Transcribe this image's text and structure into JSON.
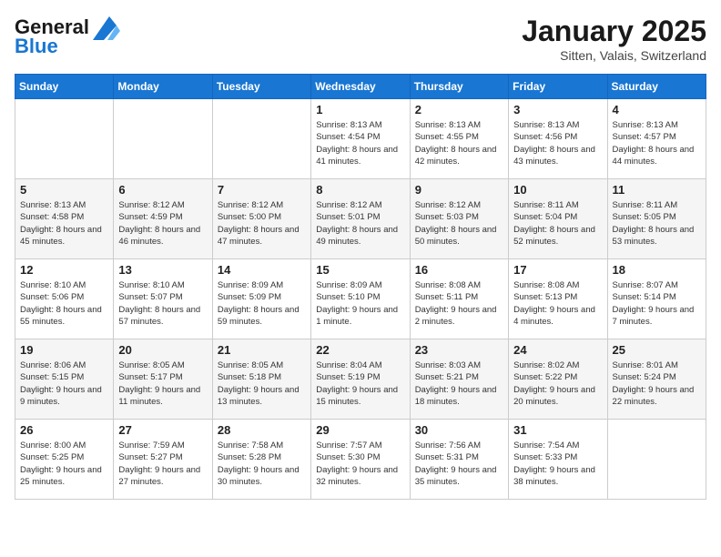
{
  "header": {
    "logo_line1": "General",
    "logo_line2": "Blue",
    "title": "January 2025",
    "subtitle": "Sitten, Valais, Switzerland"
  },
  "weekdays": [
    "Sunday",
    "Monday",
    "Tuesday",
    "Wednesday",
    "Thursday",
    "Friday",
    "Saturday"
  ],
  "weeks": [
    [
      {
        "day": "",
        "info": ""
      },
      {
        "day": "",
        "info": ""
      },
      {
        "day": "",
        "info": ""
      },
      {
        "day": "1",
        "info": "Sunrise: 8:13 AM\nSunset: 4:54 PM\nDaylight: 8 hours and 41 minutes."
      },
      {
        "day": "2",
        "info": "Sunrise: 8:13 AM\nSunset: 4:55 PM\nDaylight: 8 hours and 42 minutes."
      },
      {
        "day": "3",
        "info": "Sunrise: 8:13 AM\nSunset: 4:56 PM\nDaylight: 8 hours and 43 minutes."
      },
      {
        "day": "4",
        "info": "Sunrise: 8:13 AM\nSunset: 4:57 PM\nDaylight: 8 hours and 44 minutes."
      }
    ],
    [
      {
        "day": "5",
        "info": "Sunrise: 8:13 AM\nSunset: 4:58 PM\nDaylight: 8 hours and 45 minutes."
      },
      {
        "day": "6",
        "info": "Sunrise: 8:12 AM\nSunset: 4:59 PM\nDaylight: 8 hours and 46 minutes."
      },
      {
        "day": "7",
        "info": "Sunrise: 8:12 AM\nSunset: 5:00 PM\nDaylight: 8 hours and 47 minutes."
      },
      {
        "day": "8",
        "info": "Sunrise: 8:12 AM\nSunset: 5:01 PM\nDaylight: 8 hours and 49 minutes."
      },
      {
        "day": "9",
        "info": "Sunrise: 8:12 AM\nSunset: 5:03 PM\nDaylight: 8 hours and 50 minutes."
      },
      {
        "day": "10",
        "info": "Sunrise: 8:11 AM\nSunset: 5:04 PM\nDaylight: 8 hours and 52 minutes."
      },
      {
        "day": "11",
        "info": "Sunrise: 8:11 AM\nSunset: 5:05 PM\nDaylight: 8 hours and 53 minutes."
      }
    ],
    [
      {
        "day": "12",
        "info": "Sunrise: 8:10 AM\nSunset: 5:06 PM\nDaylight: 8 hours and 55 minutes."
      },
      {
        "day": "13",
        "info": "Sunrise: 8:10 AM\nSunset: 5:07 PM\nDaylight: 8 hours and 57 minutes."
      },
      {
        "day": "14",
        "info": "Sunrise: 8:09 AM\nSunset: 5:09 PM\nDaylight: 8 hours and 59 minutes."
      },
      {
        "day": "15",
        "info": "Sunrise: 8:09 AM\nSunset: 5:10 PM\nDaylight: 9 hours and 1 minute."
      },
      {
        "day": "16",
        "info": "Sunrise: 8:08 AM\nSunset: 5:11 PM\nDaylight: 9 hours and 2 minutes."
      },
      {
        "day": "17",
        "info": "Sunrise: 8:08 AM\nSunset: 5:13 PM\nDaylight: 9 hours and 4 minutes."
      },
      {
        "day": "18",
        "info": "Sunrise: 8:07 AM\nSunset: 5:14 PM\nDaylight: 9 hours and 7 minutes."
      }
    ],
    [
      {
        "day": "19",
        "info": "Sunrise: 8:06 AM\nSunset: 5:15 PM\nDaylight: 9 hours and 9 minutes."
      },
      {
        "day": "20",
        "info": "Sunrise: 8:05 AM\nSunset: 5:17 PM\nDaylight: 9 hours and 11 minutes."
      },
      {
        "day": "21",
        "info": "Sunrise: 8:05 AM\nSunset: 5:18 PM\nDaylight: 9 hours and 13 minutes."
      },
      {
        "day": "22",
        "info": "Sunrise: 8:04 AM\nSunset: 5:19 PM\nDaylight: 9 hours and 15 minutes."
      },
      {
        "day": "23",
        "info": "Sunrise: 8:03 AM\nSunset: 5:21 PM\nDaylight: 9 hours and 18 minutes."
      },
      {
        "day": "24",
        "info": "Sunrise: 8:02 AM\nSunset: 5:22 PM\nDaylight: 9 hours and 20 minutes."
      },
      {
        "day": "25",
        "info": "Sunrise: 8:01 AM\nSunset: 5:24 PM\nDaylight: 9 hours and 22 minutes."
      }
    ],
    [
      {
        "day": "26",
        "info": "Sunrise: 8:00 AM\nSunset: 5:25 PM\nDaylight: 9 hours and 25 minutes."
      },
      {
        "day": "27",
        "info": "Sunrise: 7:59 AM\nSunset: 5:27 PM\nDaylight: 9 hours and 27 minutes."
      },
      {
        "day": "28",
        "info": "Sunrise: 7:58 AM\nSunset: 5:28 PM\nDaylight: 9 hours and 30 minutes."
      },
      {
        "day": "29",
        "info": "Sunrise: 7:57 AM\nSunset: 5:30 PM\nDaylight: 9 hours and 32 minutes."
      },
      {
        "day": "30",
        "info": "Sunrise: 7:56 AM\nSunset: 5:31 PM\nDaylight: 9 hours and 35 minutes."
      },
      {
        "day": "31",
        "info": "Sunrise: 7:54 AM\nSunset: 5:33 PM\nDaylight: 9 hours and 38 minutes."
      },
      {
        "day": "",
        "info": ""
      }
    ]
  ]
}
